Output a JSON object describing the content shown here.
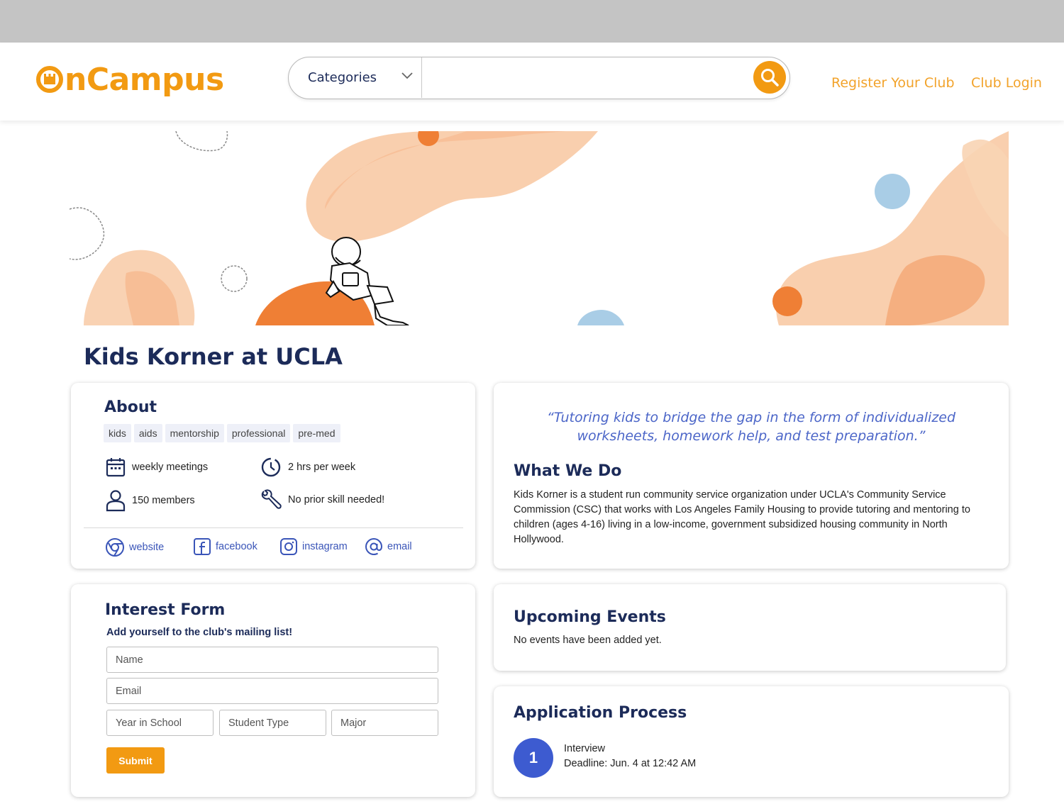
{
  "header": {
    "logo_text": "nCampus",
    "categories_label": "Categories",
    "search_placeholder": "",
    "nav": {
      "register": "Register Your Club",
      "login": "Club Login"
    }
  },
  "club": {
    "name": "Kids Korner at UCLA",
    "about": {
      "title": "About",
      "tags": [
        "kids",
        "aids",
        "mentorship",
        "professional",
        "pre-med"
      ],
      "facts": {
        "meetings": "weekly meetings",
        "time": "2 hrs per week",
        "members": "150 members",
        "skill": "No prior skill needed!"
      },
      "links": {
        "website": "website",
        "facebook": "facebook",
        "instagram": "instagram",
        "email": "email"
      }
    },
    "what_we_do": {
      "quote": "“Tutoring kids to bridge the gap in the form of individualized worksheets, homework help, and test preparation.”",
      "title": "What We Do",
      "body": "Kids Korner is a student run community service organization under UCLA's Community Service Commission (CSC) that works with Los Angeles Family Housing to provide tutoring and mentoring to children (ages 4-16) living in a low-income, government subsidized housing community in North Hollywood."
    },
    "interest_form": {
      "title": "Interest Form",
      "subtitle": "Add yourself to the club's mailing list!",
      "placeholders": {
        "name": "Name",
        "email": "Email",
        "year": "Year in School",
        "type": "Student Type",
        "major": "Major"
      },
      "submit_label": "Submit"
    },
    "events": {
      "title": "Upcoming Events",
      "empty_text": "No events have been added yet."
    },
    "application": {
      "title": "Application Process",
      "steps": [
        {
          "number": "1",
          "name": "Interview",
          "deadline": "Deadline: Jun. 4 at 12:42 AM"
        }
      ]
    }
  },
  "colors": {
    "brand": "#f29a12",
    "navy": "#1c2b59",
    "accent_blue": "#3d5bd0",
    "quote_blue": "#4c66c8"
  },
  "icons": [
    "castle-logo-icon",
    "chevron-down-icon",
    "search-icon",
    "calendar-icon",
    "clock-icon",
    "person-icon",
    "wrench-icon",
    "chrome-icon",
    "facebook-icon",
    "instagram-icon",
    "at-sign-icon"
  ]
}
